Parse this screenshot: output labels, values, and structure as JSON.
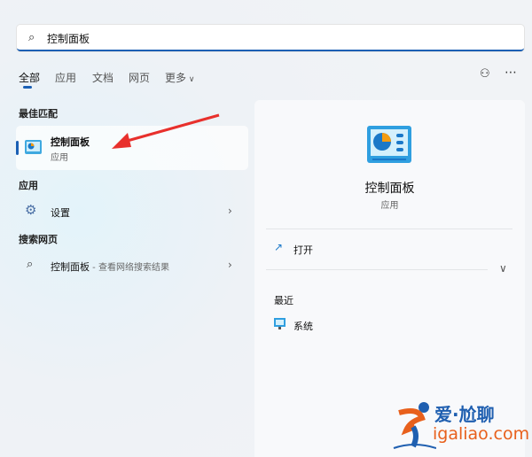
{
  "search": {
    "value": "控制面板",
    "icon": "search-icon"
  },
  "tabs": [
    {
      "label": "全部",
      "active": true
    },
    {
      "label": "应用"
    },
    {
      "label": "文档"
    },
    {
      "label": "网页"
    },
    {
      "label": "更多"
    }
  ],
  "best_match": {
    "heading": "最佳匹配",
    "title": "控制面板",
    "subtitle": "应用"
  },
  "apps": {
    "heading": "应用",
    "items": [
      {
        "label": "设置"
      }
    ]
  },
  "web": {
    "heading": "搜索网页",
    "query": "控制面板",
    "suffix": " - 查看网络搜索结果"
  },
  "detail": {
    "title": "控制面板",
    "subtitle": "应用",
    "open": "打开",
    "recent_heading": "最近",
    "recent": [
      {
        "label": "系统"
      }
    ]
  },
  "watermark": {
    "cn": "爱·尬聊",
    "url": "igaliao.com"
  },
  "colors": {
    "accent": "#1a5fb4",
    "arrow": "#e8302c",
    "logo_blue": "#1f5fb0",
    "logo_orange": "#e8601c"
  }
}
